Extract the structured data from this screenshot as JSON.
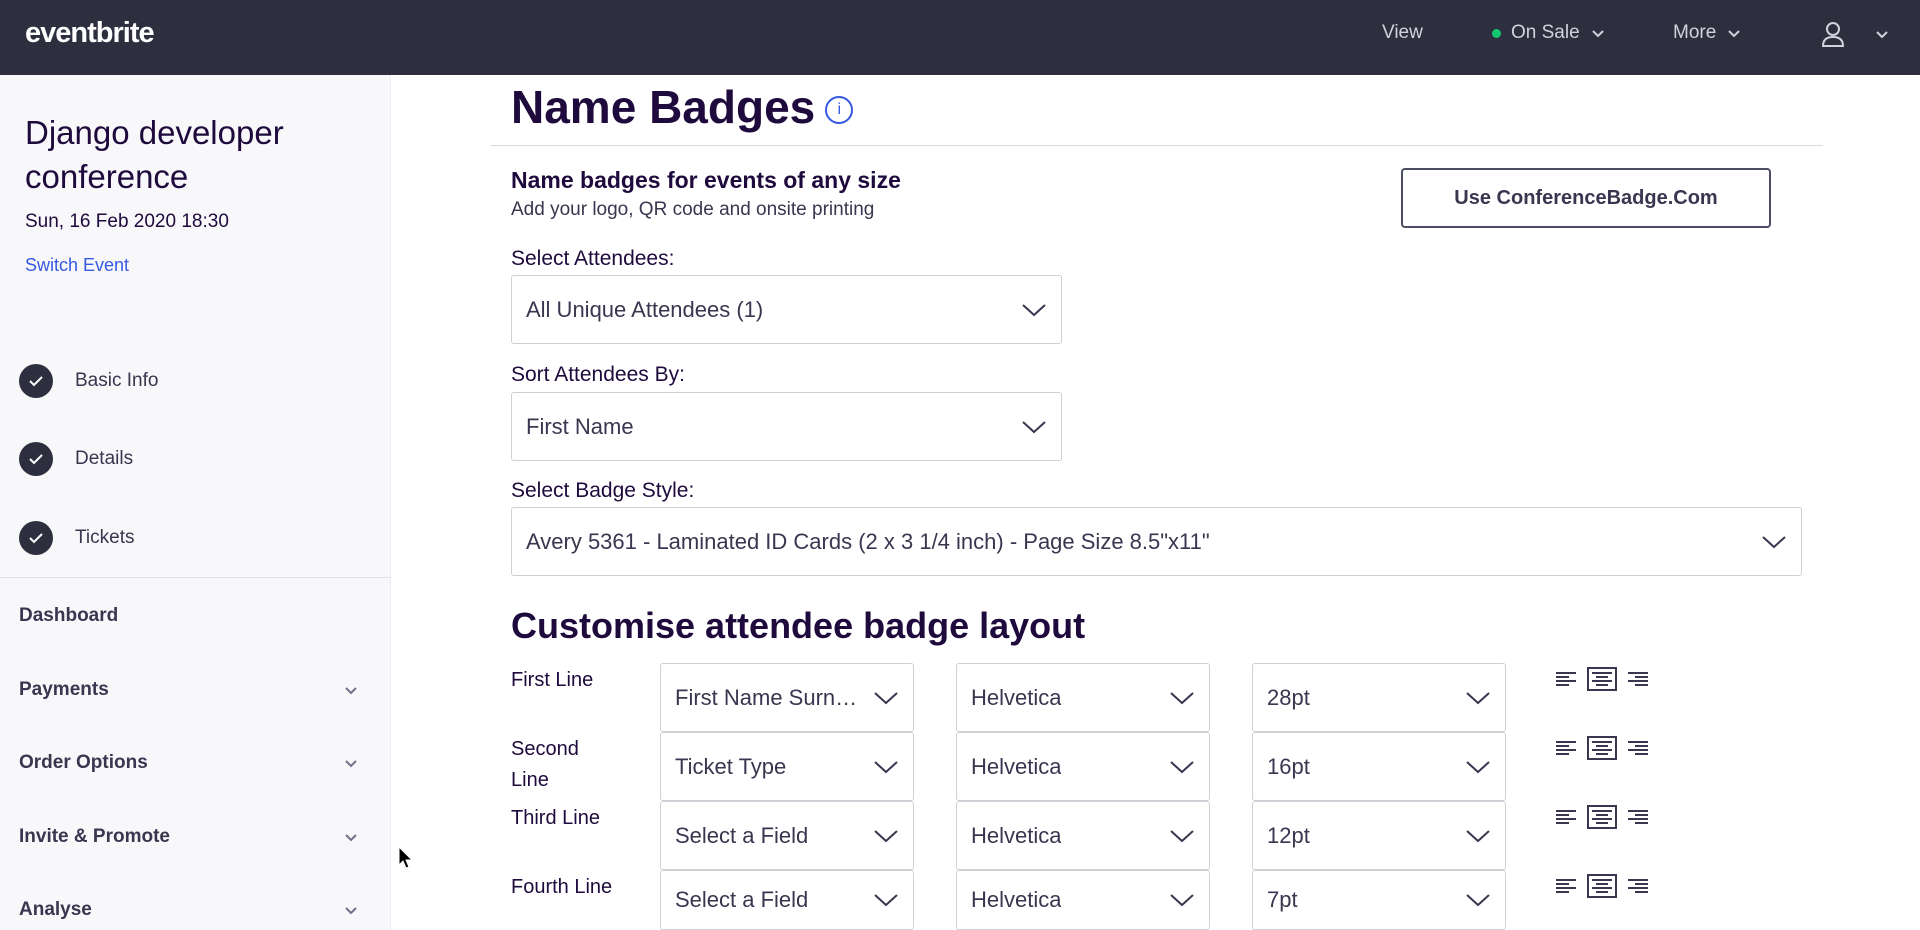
{
  "topbar": {
    "logo": "eventbrite",
    "view": "View",
    "status": "On Sale",
    "status_color": "#14c871",
    "more": "More"
  },
  "sidebar": {
    "event_title": "Django developer conference",
    "event_date": "Sun, 16 Feb 2020 18:30",
    "switch_event": "Switch Event",
    "steps": [
      {
        "label": "Basic Info"
      },
      {
        "label": "Details"
      },
      {
        "label": "Tickets"
      }
    ],
    "nav": [
      {
        "label": "Dashboard"
      },
      {
        "label": "Payments"
      },
      {
        "label": "Order Options"
      },
      {
        "label": "Invite & Promote"
      },
      {
        "label": "Analyse"
      }
    ]
  },
  "main": {
    "title": "Name Badges",
    "info_icon": "i",
    "promo_title": "Name badges for events of any size",
    "promo_sub": "Add your logo, QR code and onsite printing",
    "promo_button": "Use ConferenceBadge.Com",
    "select_attendees_label": "Select Attendees:",
    "select_attendees_value": "All Unique Attendees (1)",
    "sort_label": "Sort Attendees By:",
    "sort_value": "First Name",
    "badge_style_label": "Select Badge Style:",
    "badge_style_value": "Avery 5361 - Laminated ID Cards (2 x 3 1/4 inch) - Page Size 8.5\"x11\"",
    "layout_title": "Customise attendee badge layout",
    "lines": [
      {
        "label": "First Line",
        "field": "First Name Surname",
        "font": "Helvetica",
        "size": "28pt"
      },
      {
        "label": "Second Line",
        "field": "Ticket Type",
        "font": "Helvetica",
        "size": "16pt"
      },
      {
        "label": "Third Line",
        "field": "Select a Field",
        "font": "Helvetica",
        "size": "12pt"
      },
      {
        "label": "Fourth Line",
        "field": "Select a Field",
        "font": "Helvetica",
        "size": "7pt"
      }
    ]
  },
  "icons": {
    "check": "check-icon",
    "chevron": "chevron-down-icon",
    "user": "user-icon",
    "align_left": "align-left-icon",
    "align_center": "align-center-icon",
    "align_right": "align-right-icon"
  }
}
